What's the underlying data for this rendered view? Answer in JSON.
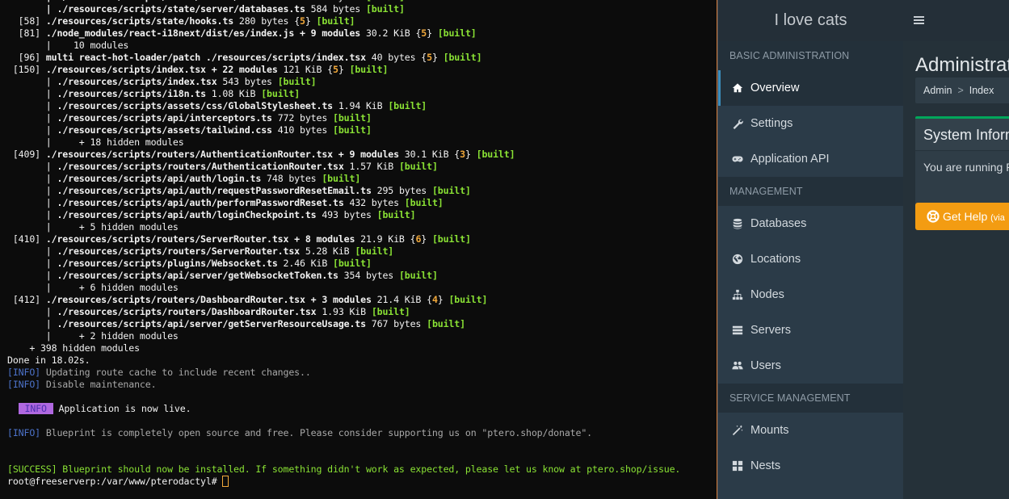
{
  "terminal": {
    "lines": [
      [
        {
          "t": "       | ./resources/scripts/state/server/databases.ts ",
          "c": "white b"
        },
        {
          "t": "584 bytes ",
          "c": "white"
        },
        {
          "t": "[built]",
          "c": "green"
        }
      ],
      [
        {
          "t": "       | ./resources/scripts/state/server/databases.ts ",
          "c": "white b"
        },
        {
          "t": "584 bytes ",
          "c": "white"
        },
        {
          "t": "[built]",
          "c": "green"
        }
      ],
      [
        {
          "t": "  [58] ",
          "c": "white"
        },
        {
          "t": "./resources/scripts/state/hooks.ts ",
          "c": "white b"
        },
        {
          "t": "280 bytes ",
          "c": "white"
        },
        {
          "t": "{",
          "c": "white"
        },
        {
          "t": "5",
          "c": "yellow"
        },
        {
          "t": "} ",
          "c": "white"
        },
        {
          "t": "[built]",
          "c": "green"
        }
      ],
      [
        {
          "t": "  [81] ",
          "c": "white"
        },
        {
          "t": "./node_modules/react-i18next/dist/es/index.js + 9 modules ",
          "c": "white b"
        },
        {
          "t": "30.2 KiB ",
          "c": "white"
        },
        {
          "t": "{",
          "c": "white"
        },
        {
          "t": "5",
          "c": "yellow"
        },
        {
          "t": "} ",
          "c": "white"
        },
        {
          "t": "[built]",
          "c": "green"
        }
      ],
      [
        {
          "t": "       |    10 modules",
          "c": "white"
        }
      ],
      [
        {
          "t": "  [96] ",
          "c": "white"
        },
        {
          "t": "multi react-hot-loader/patch ./resources/scripts/index.tsx ",
          "c": "white b"
        },
        {
          "t": "40 bytes ",
          "c": "white"
        },
        {
          "t": "{",
          "c": "white"
        },
        {
          "t": "5",
          "c": "yellow"
        },
        {
          "t": "} ",
          "c": "white"
        },
        {
          "t": "[built]",
          "c": "green"
        }
      ],
      [
        {
          "t": " [150] ",
          "c": "white"
        },
        {
          "t": "./resources/scripts/index.tsx + 22 modules ",
          "c": "white b"
        },
        {
          "t": "121 KiB ",
          "c": "white"
        },
        {
          "t": "{",
          "c": "white"
        },
        {
          "t": "5",
          "c": "yellow"
        },
        {
          "t": "} ",
          "c": "white"
        },
        {
          "t": "[built]",
          "c": "green"
        }
      ],
      [
        {
          "t": "       | ",
          "c": "white"
        },
        {
          "t": "./resources/scripts/index.tsx ",
          "c": "white b"
        },
        {
          "t": "543 bytes ",
          "c": "white"
        },
        {
          "t": "[built]",
          "c": "green"
        }
      ],
      [
        {
          "t": "       | ",
          "c": "white"
        },
        {
          "t": "./resources/scripts/i18n.ts ",
          "c": "white b"
        },
        {
          "t": "1.08 KiB ",
          "c": "white"
        },
        {
          "t": "[built]",
          "c": "green"
        }
      ],
      [
        {
          "t": "       | ",
          "c": "white"
        },
        {
          "t": "./resources/scripts/assets/css/GlobalStylesheet.ts ",
          "c": "white b"
        },
        {
          "t": "1.94 KiB ",
          "c": "white"
        },
        {
          "t": "[built]",
          "c": "green"
        }
      ],
      [
        {
          "t": "       | ",
          "c": "white"
        },
        {
          "t": "./resources/scripts/api/interceptors.ts ",
          "c": "white b"
        },
        {
          "t": "772 bytes ",
          "c": "white"
        },
        {
          "t": "[built]",
          "c": "green"
        }
      ],
      [
        {
          "t": "       | ",
          "c": "white"
        },
        {
          "t": "./resources/scripts/assets/tailwind.css ",
          "c": "white b"
        },
        {
          "t": "410 bytes ",
          "c": "white"
        },
        {
          "t": "[built]",
          "c": "green"
        }
      ],
      [
        {
          "t": "       |     + 18 hidden modules",
          "c": "white"
        }
      ],
      [
        {
          "t": " [409] ",
          "c": "white"
        },
        {
          "t": "./resources/scripts/routers/AuthenticationRouter.tsx + 9 modules ",
          "c": "white b"
        },
        {
          "t": "30.1 KiB ",
          "c": "white"
        },
        {
          "t": "{",
          "c": "white"
        },
        {
          "t": "3",
          "c": "yellow"
        },
        {
          "t": "} ",
          "c": "white"
        },
        {
          "t": "[built]",
          "c": "green"
        }
      ],
      [
        {
          "t": "       | ",
          "c": "white"
        },
        {
          "t": "./resources/scripts/routers/AuthenticationRouter.tsx ",
          "c": "white b"
        },
        {
          "t": "1.57 KiB ",
          "c": "white"
        },
        {
          "t": "[built]",
          "c": "green"
        }
      ],
      [
        {
          "t": "       | ",
          "c": "white"
        },
        {
          "t": "./resources/scripts/api/auth/login.ts ",
          "c": "white b"
        },
        {
          "t": "748 bytes ",
          "c": "white"
        },
        {
          "t": "[built]",
          "c": "green"
        }
      ],
      [
        {
          "t": "       | ",
          "c": "white"
        },
        {
          "t": "./resources/scripts/api/auth/requestPasswordResetEmail.ts ",
          "c": "white b"
        },
        {
          "t": "295 bytes ",
          "c": "white"
        },
        {
          "t": "[built]",
          "c": "green"
        }
      ],
      [
        {
          "t": "       | ",
          "c": "white"
        },
        {
          "t": "./resources/scripts/api/auth/performPasswordReset.ts ",
          "c": "white b"
        },
        {
          "t": "432 bytes ",
          "c": "white"
        },
        {
          "t": "[built]",
          "c": "green"
        }
      ],
      [
        {
          "t": "       | ",
          "c": "white"
        },
        {
          "t": "./resources/scripts/api/auth/loginCheckpoint.ts ",
          "c": "white b"
        },
        {
          "t": "493 bytes ",
          "c": "white"
        },
        {
          "t": "[built]",
          "c": "green"
        }
      ],
      [
        {
          "t": "       |     + 5 hidden modules",
          "c": "white"
        }
      ],
      [
        {
          "t": " [410] ",
          "c": "white"
        },
        {
          "t": "./resources/scripts/routers/ServerRouter.tsx + 8 modules ",
          "c": "white b"
        },
        {
          "t": "21.9 KiB ",
          "c": "white"
        },
        {
          "t": "{",
          "c": "white"
        },
        {
          "t": "6",
          "c": "yellow"
        },
        {
          "t": "} ",
          "c": "white"
        },
        {
          "t": "[built]",
          "c": "green"
        }
      ],
      [
        {
          "t": "       | ",
          "c": "white"
        },
        {
          "t": "./resources/scripts/routers/ServerRouter.tsx ",
          "c": "white b"
        },
        {
          "t": "5.28 KiB ",
          "c": "white"
        },
        {
          "t": "[built]",
          "c": "green"
        }
      ],
      [
        {
          "t": "       | ",
          "c": "white"
        },
        {
          "t": "./resources/scripts/plugins/Websocket.ts ",
          "c": "white b"
        },
        {
          "t": "2.46 KiB ",
          "c": "white"
        },
        {
          "t": "[built]",
          "c": "green"
        }
      ],
      [
        {
          "t": "       | ",
          "c": "white"
        },
        {
          "t": "./resources/scripts/api/server/getWebsocketToken.ts ",
          "c": "white b"
        },
        {
          "t": "354 bytes ",
          "c": "white"
        },
        {
          "t": "[built]",
          "c": "green"
        }
      ],
      [
        {
          "t": "       |     + 6 hidden modules",
          "c": "white"
        }
      ],
      [
        {
          "t": " [412] ",
          "c": "white"
        },
        {
          "t": "./resources/scripts/routers/DashboardRouter.tsx + 3 modules ",
          "c": "white b"
        },
        {
          "t": "21.4 KiB ",
          "c": "white"
        },
        {
          "t": "{",
          "c": "white"
        },
        {
          "t": "4",
          "c": "yellow"
        },
        {
          "t": "} ",
          "c": "white"
        },
        {
          "t": "[built]",
          "c": "green"
        }
      ],
      [
        {
          "t": "       | ",
          "c": "white"
        },
        {
          "t": "./resources/scripts/routers/DashboardRouter.tsx ",
          "c": "white b"
        },
        {
          "t": "1.93 KiB ",
          "c": "white"
        },
        {
          "t": "[built]",
          "c": "green"
        }
      ],
      [
        {
          "t": "       | ",
          "c": "white"
        },
        {
          "t": "./resources/scripts/api/server/getServerResourceUsage.ts ",
          "c": "white b"
        },
        {
          "t": "767 bytes ",
          "c": "white"
        },
        {
          "t": "[built]",
          "c": "green"
        }
      ],
      [
        {
          "t": "       |     + 2 hidden modules",
          "c": "white"
        }
      ],
      [
        {
          "t": "    + 398 hidden modules",
          "c": "white"
        }
      ],
      [
        {
          "t": "Done in 18.02s.",
          "c": "white"
        }
      ],
      [
        {
          "t": "[INFO] ",
          "c": "info"
        },
        {
          "t": "Updating route cache to include recent changes..",
          "c": "grey"
        }
      ],
      [
        {
          "t": "[INFO] ",
          "c": "info"
        },
        {
          "t": "Disable maintenance.",
          "c": "grey"
        }
      ],
      [
        {
          "t": "",
          "c": "white"
        }
      ],
      [
        {
          "t": "  ",
          "c": "white"
        },
        {
          "t": " INFO ",
          "c": "badge"
        },
        {
          "t": " Application is now live.",
          "c": "white"
        }
      ],
      [
        {
          "t": "",
          "c": "white"
        }
      ],
      [
        {
          "t": "[INFO] ",
          "c": "info"
        },
        {
          "t": "Blueprint is completely open source and free. Please consider supporting us on \"ptero.shop/donate\".",
          "c": "grey"
        }
      ],
      [
        {
          "t": "",
          "c": "white"
        }
      ],
      [
        {
          "t": "",
          "c": "white"
        }
      ],
      [
        {
          "t": "[SUCCESS] Blueprint should now be installed. If something didn't work as expected, please let us know at ptero.shop/issue.",
          "c": "success"
        }
      ],
      [
        {
          "t": "root@freeserverp:/var/www/pterodactyl# ",
          "c": "white"
        },
        {
          "t": "",
          "c": "cursor"
        }
      ]
    ]
  },
  "panel": {
    "brand": "I love cats",
    "menu_toggle_icon": "hamburger-icon",
    "sidebar": [
      {
        "type": "header",
        "label": "Basic Administration"
      },
      {
        "type": "item",
        "label": "Overview",
        "icon": "home-icon",
        "active": true
      },
      {
        "type": "item",
        "label": "Settings",
        "icon": "wrench-icon"
      },
      {
        "type": "item",
        "label": "Application API",
        "icon": "gamepad-icon"
      },
      {
        "type": "header",
        "label": "Management"
      },
      {
        "type": "item",
        "label": "Databases",
        "icon": "database-icon"
      },
      {
        "type": "item",
        "label": "Locations",
        "icon": "globe-icon"
      },
      {
        "type": "item",
        "label": "Nodes",
        "icon": "sitemap-icon"
      },
      {
        "type": "item",
        "label": "Servers",
        "icon": "server-icon"
      },
      {
        "type": "item",
        "label": "Users",
        "icon": "users-icon"
      },
      {
        "type": "header",
        "label": "Service Management"
      },
      {
        "type": "item",
        "label": "Mounts",
        "icon": "magic-icon"
      },
      {
        "type": "item",
        "label": "Nests",
        "icon": "th-large-icon"
      }
    ],
    "content": {
      "title": "Administrat",
      "breadcrumb": [
        "Admin",
        "Index"
      ],
      "info_box_title": "System Inform",
      "info_box_text": "You are running P",
      "help_button_label": "Get Help",
      "help_button_small": "(via",
      "help_button_icon": "life-ring-icon"
    },
    "colors": {
      "accent": "#3c8dbc",
      "success": "#00a65a",
      "warning": "#f39c12"
    }
  }
}
